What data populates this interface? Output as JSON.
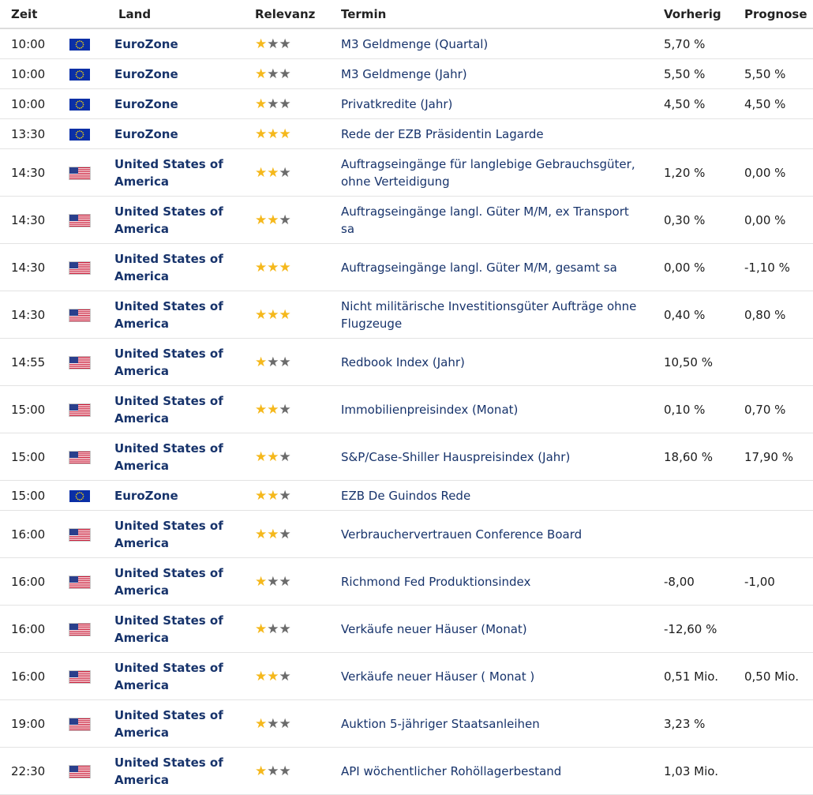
{
  "columns": {
    "time": "Zeit",
    "country": "Land",
    "relevance": "Relevanz",
    "event": "Termin",
    "previous": "Vorherig",
    "forecast": "Prognose"
  },
  "colors": {
    "link_blue": "#17336b",
    "star_active": "#f5b81c",
    "star_inactive": "#6b6b6b"
  },
  "rows": [
    {
      "time": "10:00",
      "flag": "eu-flag-icon",
      "country": "EuroZone",
      "relevance": 1,
      "event": "M3 Geldmenge (Quartal)",
      "previous": "5,70 %",
      "forecast": ""
    },
    {
      "time": "10:00",
      "flag": "eu-flag-icon",
      "country": "EuroZone",
      "relevance": 1,
      "event": "M3 Geldmenge (Jahr)",
      "previous": "5,50 %",
      "forecast": "5,50 %"
    },
    {
      "time": "10:00",
      "flag": "eu-flag-icon",
      "country": "EuroZone",
      "relevance": 1,
      "event": "Privatkredite (Jahr)",
      "previous": "4,50 %",
      "forecast": "4,50 %"
    },
    {
      "time": "13:30",
      "flag": "eu-flag-icon",
      "country": "EuroZone",
      "relevance": 3,
      "event": "Rede der EZB Präsidentin Lagarde",
      "previous": "",
      "forecast": ""
    },
    {
      "time": "14:30",
      "flag": "us-flag-icon",
      "country": "United States of America",
      "relevance": 2,
      "event": "Auftragseingänge für langlebige Gebrauchsgüter, ohne Verteidigung",
      "previous": "1,20 %",
      "forecast": "0,00 %"
    },
    {
      "time": "14:30",
      "flag": "us-flag-icon",
      "country": "United States of America",
      "relevance": 2,
      "event": "Auftragseingänge langl. Güter M/M, ex Transport sa",
      "previous": "0,30 %",
      "forecast": "0,00 %"
    },
    {
      "time": "14:30",
      "flag": "us-flag-icon",
      "country": "United States of America",
      "relevance": 3,
      "event": "Auftragseingänge langl. Güter M/M, gesamt sa",
      "previous": "0,00 %",
      "forecast": "-1,10 %"
    },
    {
      "time": "14:30",
      "flag": "us-flag-icon",
      "country": "United States of America",
      "relevance": 3,
      "event": "Nicht militärische Investitionsgüter Aufträge ohne Flugzeuge",
      "previous": "0,40 %",
      "forecast": "0,80 %"
    },
    {
      "time": "14:55",
      "flag": "us-flag-icon",
      "country": "United States of America",
      "relevance": 1,
      "event": "Redbook Index (Jahr)",
      "previous": "10,50 %",
      "forecast": ""
    },
    {
      "time": "15:00",
      "flag": "us-flag-icon",
      "country": "United States of America",
      "relevance": 2,
      "event": "Immobilienpreisindex (Monat)",
      "previous": "0,10 %",
      "forecast": "0,70 %"
    },
    {
      "time": "15:00",
      "flag": "us-flag-icon",
      "country": "United States of America",
      "relevance": 2,
      "event": "S&P/Case-Shiller Hauspreisindex (Jahr)",
      "previous": "18,60 %",
      "forecast": "17,90 %"
    },
    {
      "time": "15:00",
      "flag": "eu-flag-icon",
      "country": "EuroZone",
      "relevance": 2,
      "event": "EZB De Guindos Rede",
      "previous": "",
      "forecast": ""
    },
    {
      "time": "16:00",
      "flag": "us-flag-icon",
      "country": "United States of America",
      "relevance": 2,
      "event": "Verbrauchervertrauen Conference Board",
      "previous": "",
      "forecast": ""
    },
    {
      "time": "16:00",
      "flag": "us-flag-icon",
      "country": "United States of America",
      "relevance": 1,
      "event": "Richmond Fed Produktionsindex",
      "previous": "-8,00",
      "forecast": "-1,00"
    },
    {
      "time": "16:00",
      "flag": "us-flag-icon",
      "country": "United States of America",
      "relevance": 1,
      "event": "Verkäufe neuer Häuser (Monat)",
      "previous": "-12,60 %",
      "forecast": ""
    },
    {
      "time": "16:00",
      "flag": "us-flag-icon",
      "country": "United States of America",
      "relevance": 2,
      "event": "Verkäufe neuer Häuser ( Monat )",
      "previous": "0,51 Mio.",
      "forecast": "0,50 Mio."
    },
    {
      "time": "19:00",
      "flag": "us-flag-icon",
      "country": "United States of America",
      "relevance": 1,
      "event": "Auktion 5-jähriger Staatsanleihen",
      "previous": "3,23 %",
      "forecast": ""
    },
    {
      "time": "22:30",
      "flag": "us-flag-icon",
      "country": "United States of America",
      "relevance": 1,
      "event": "API wöchentlicher Rohöllagerbestand",
      "previous": "1,03 Mio.",
      "forecast": ""
    }
  ]
}
